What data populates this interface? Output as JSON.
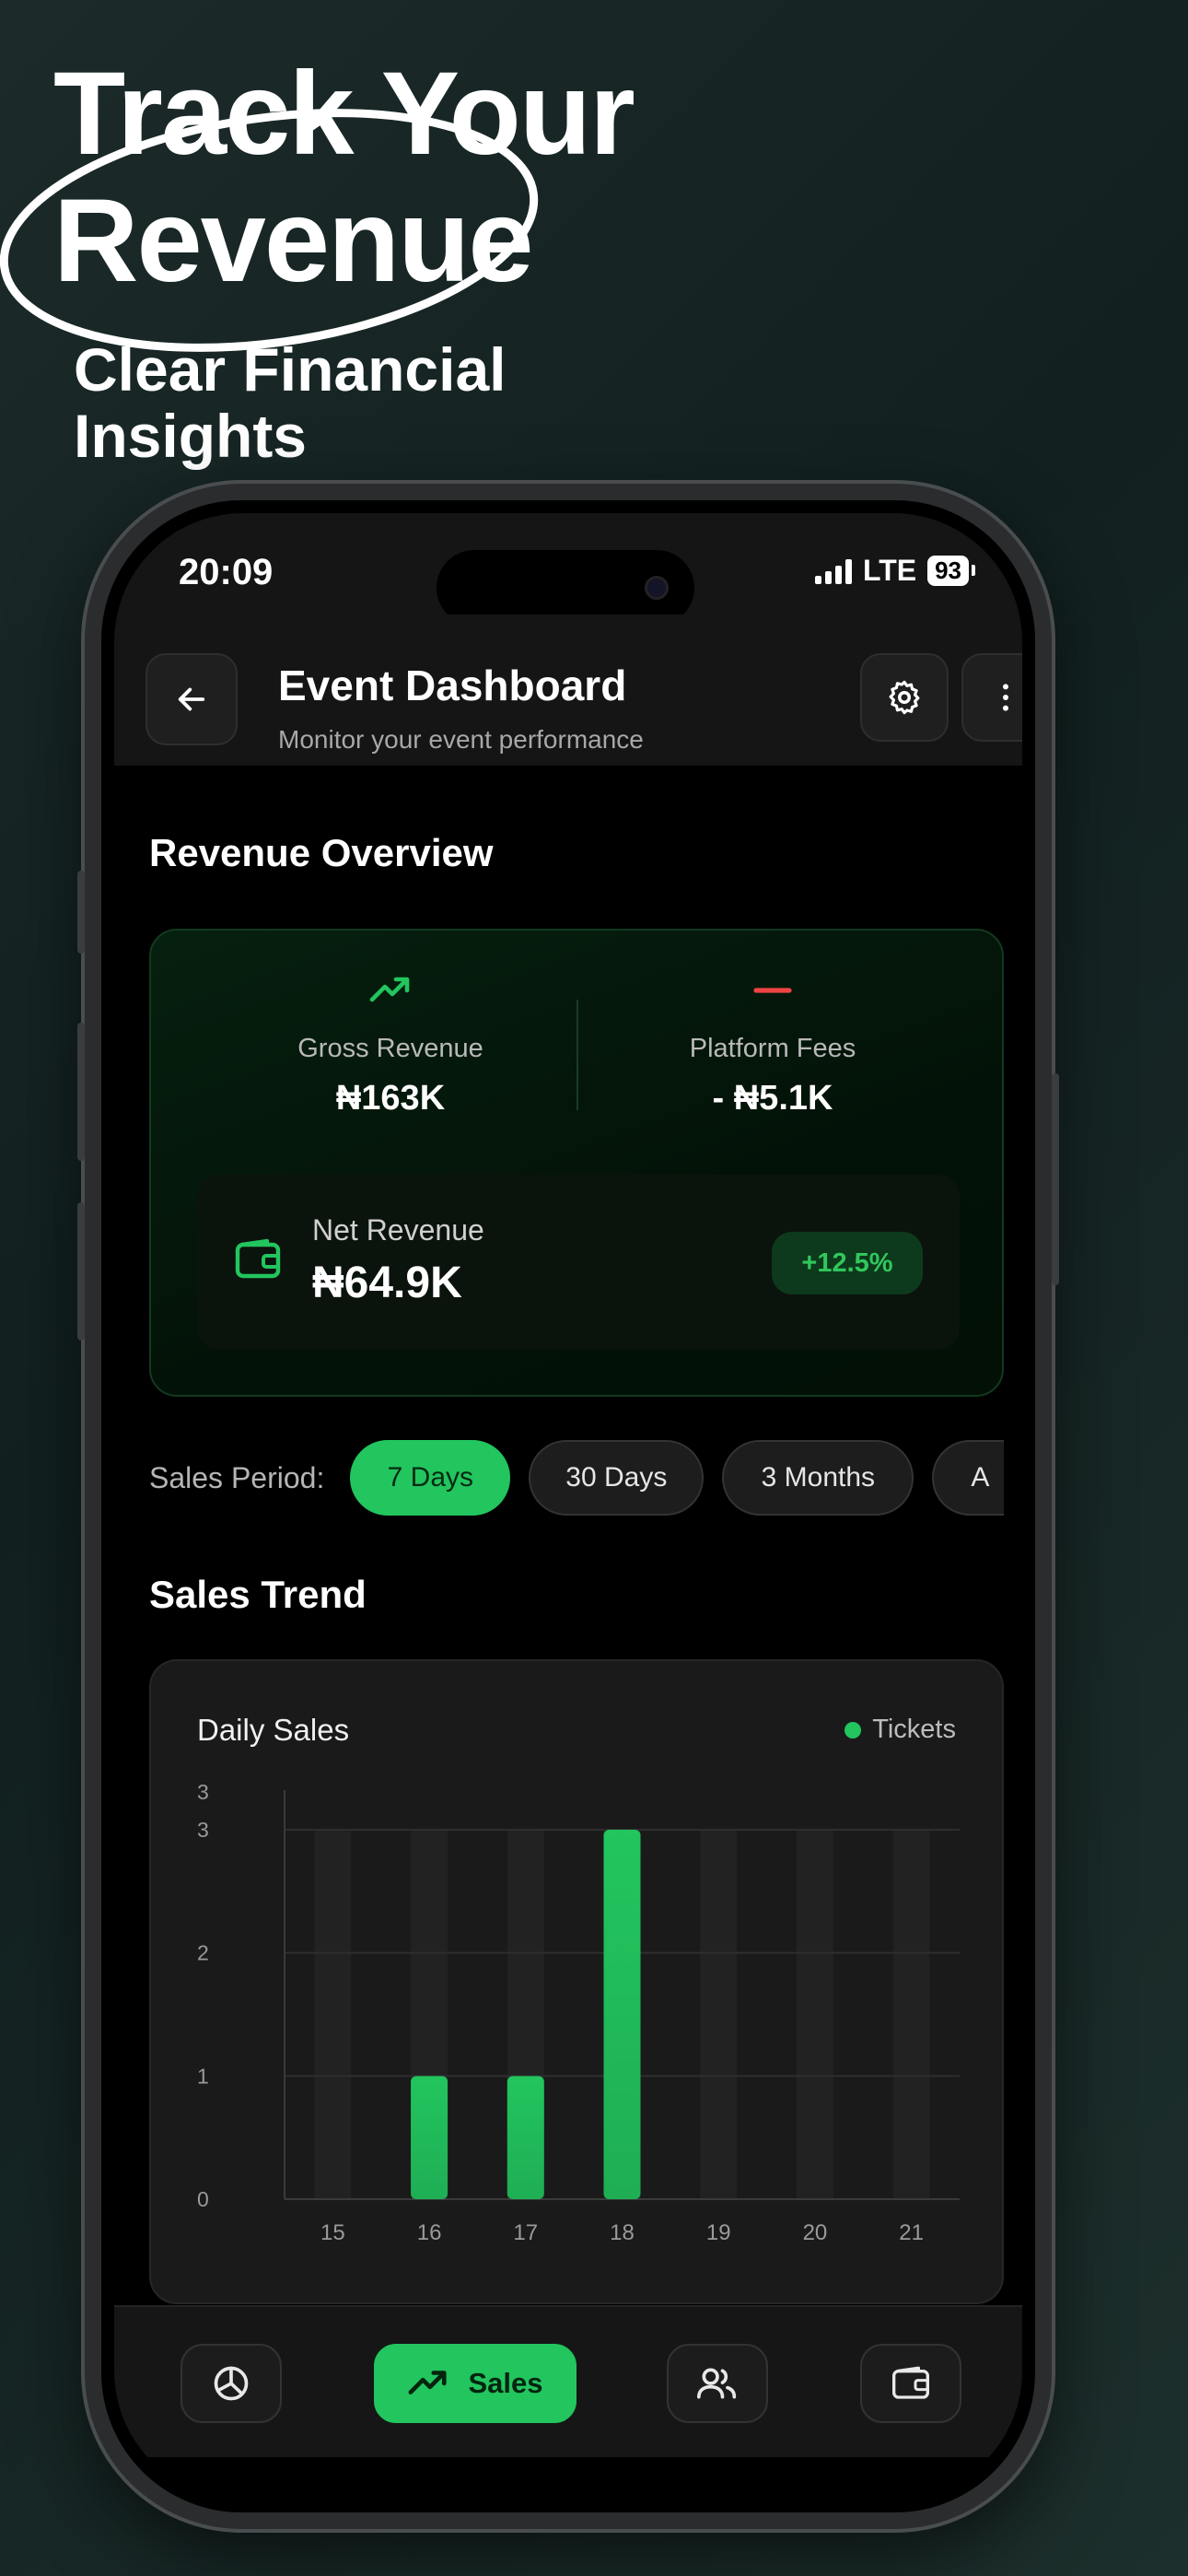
{
  "promo": {
    "headline_line1": "Track Your",
    "headline_line2": "Revenue",
    "subline_line1": "Clear Financial",
    "subline_line2": "Insights"
  },
  "status_bar": {
    "time": "20:09",
    "network": "LTE",
    "battery": "93"
  },
  "header": {
    "title": "Event Dashboard",
    "subtitle": "Monitor your event performance",
    "icons": [
      "back-arrow-icon",
      "gear-icon",
      "more-vertical-icon"
    ]
  },
  "revenue": {
    "section_title": "Revenue Overview",
    "gross_label": "Gross Revenue",
    "gross_value": "₦163K",
    "fees_label": "Platform Fees",
    "fees_value": "- ₦5.1K",
    "net_label": "Net Revenue",
    "net_value": "₦64.9K",
    "net_change": "+12.5%",
    "colors": {
      "positive": "#22c55e",
      "negative": "#ef4444"
    }
  },
  "sales_period": {
    "label": "Sales Period:",
    "options": [
      "7 Days",
      "30 Days",
      "3 Months",
      "A"
    ],
    "selected": "7 Days"
  },
  "sales_trend": {
    "section_title": "Sales Trend"
  },
  "chart_data": {
    "type": "bar",
    "title": "Daily Sales",
    "legend": [
      "Tickets"
    ],
    "categories": [
      "15",
      "16",
      "17",
      "18",
      "19",
      "20",
      "21"
    ],
    "series": [
      {
        "name": "Tickets",
        "values": [
          0,
          1,
          1,
          3,
          0,
          0,
          0
        ]
      }
    ],
    "y_tick_labels": [
      "0",
      "1",
      "2",
      "3",
      "3"
    ],
    "ylim": [
      0,
      3
    ],
    "grid": true,
    "color": "#22c55e"
  },
  "bottom_nav": {
    "items": [
      {
        "icon": "pie-chart-icon",
        "label": ""
      },
      {
        "icon": "trending-up-icon",
        "label": "Sales",
        "active": true
      },
      {
        "icon": "users-icon",
        "label": ""
      },
      {
        "icon": "wallet-icon",
        "label": ""
      }
    ]
  }
}
